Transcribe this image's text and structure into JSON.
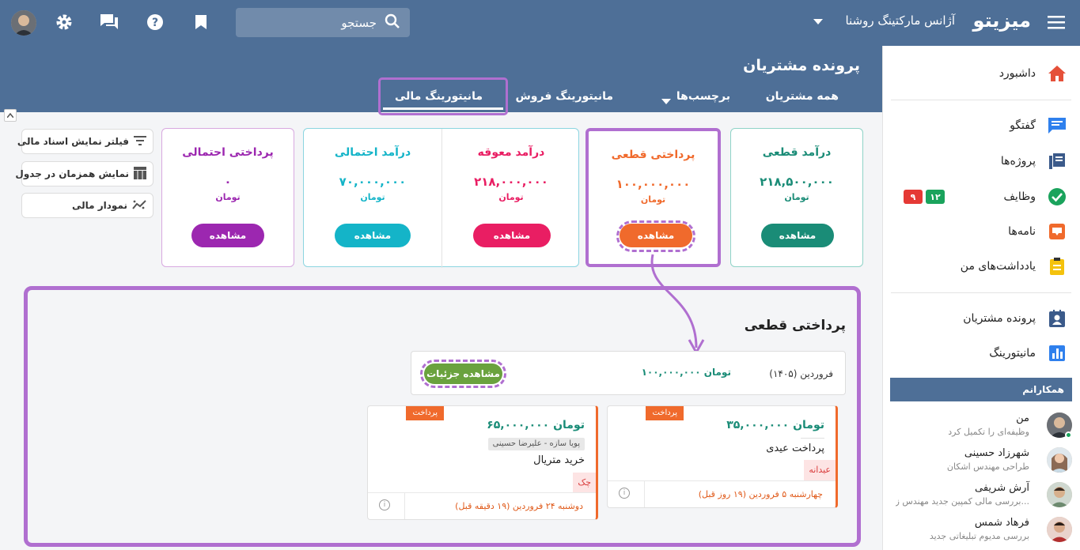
{
  "topbar": {
    "brand": "میزیتو",
    "org": "آژانس مارکتینگ روشنا",
    "search_placeholder": "جستجو"
  },
  "header": {
    "title": "پرونده مشتریان",
    "tabs": [
      {
        "label": "همه مشتریان"
      },
      {
        "label": "برچسب‌ها"
      },
      {
        "label": "مانیتورینگ فروش"
      },
      {
        "label": "مانیتورینگ مالی",
        "active": true
      }
    ]
  },
  "sidebar": {
    "items": [
      {
        "label": "داشبورد",
        "icon": "home-icon"
      },
      {
        "label": "گفتگو",
        "icon": "chat-icon"
      },
      {
        "label": "پروژه‌ها",
        "icon": "projects-icon"
      },
      {
        "label": "وظایف",
        "icon": "check-icon",
        "badges": [
          "۱۲",
          "۹"
        ]
      },
      {
        "label": "نامه‌ها",
        "icon": "mail-icon"
      },
      {
        "label": "یادداشت‌های من",
        "icon": "notes-icon"
      },
      {
        "label": "پرونده مشتریان",
        "icon": "contact-icon"
      },
      {
        "label": "مانیتورینگ",
        "icon": "chart-icon"
      }
    ],
    "coworkers_title": "همکارانم",
    "coworkers": [
      {
        "name": "من",
        "sub": "وظیفه‌ای را تکمیل کرد"
      },
      {
        "name": "شهرزاد حسینی",
        "sub": "طراحی مهندس اشکان"
      },
      {
        "name": "آرش شریفی",
        "sub": "بررسی مالی کمپین جدید مهندس ز..."
      },
      {
        "name": "فرهاد شمس",
        "sub": "بررسی مدیوم تبلیغاتی جدید"
      }
    ]
  },
  "filters": [
    {
      "label": "فیلتر نمایش اسناد مالی"
    },
    {
      "label": "نمایش همزمان در جدول"
    },
    {
      "label": "نمودار مالی"
    }
  ],
  "cards": [
    {
      "title": "درآمد قطعی",
      "value": "۲۱۸,۵۰۰,۰۰۰",
      "unit": "تومان",
      "button": "مشاهده",
      "color": "#1a8c77"
    },
    {
      "title": "پرداختی قطعی",
      "value": "۱۰۰,۰۰۰,۰۰۰",
      "unit": "تومان",
      "button": "مشاهده",
      "color": "#f06a2c"
    },
    {
      "title": "درآمد معوقه",
      "value": "۲۱۸,۰۰۰,۰۰۰",
      "unit": "تومان",
      "button": "مشاهده",
      "color": "#e91e63"
    },
    {
      "title": "درآمد احتمالی",
      "value": "۷۰,۰۰۰,۰۰۰",
      "unit": "تومان",
      "button": "مشاهده",
      "color": "#14b4c8"
    },
    {
      "title": "پرداختی احتمالی",
      "value": "۰",
      "unit": "تومان",
      "button": "مشاهده",
      "color": "#9c27b0"
    }
  ],
  "detail": {
    "title": "پرداختی قطعی",
    "summary_month": "فروردین (۱۴۰۵)",
    "summary_amount": "۱۰۰,۰۰۰,۰۰۰ تومان",
    "details_button": "مشاهده جزئیات",
    "payments": [
      {
        "tag": "پرداخت",
        "amount": "۳۵,۰۰۰,۰۰۰ تومان",
        "desc": "پرداخت عیدی",
        "type": "عیدانه",
        "date": "چهارشنبه ۵ فروردین (۱۹ روز قبل)"
      },
      {
        "tag": "پرداخت",
        "amount": "۶۵,۰۰۰,۰۰۰ تومان",
        "chip": "پویا سازه - علیرضا حسینی",
        "desc": "خرید متریال",
        "type": "چک",
        "date": "دوشنبه ۲۴ فروردین (۱۹ دقیقه قبل)"
      }
    ]
  }
}
